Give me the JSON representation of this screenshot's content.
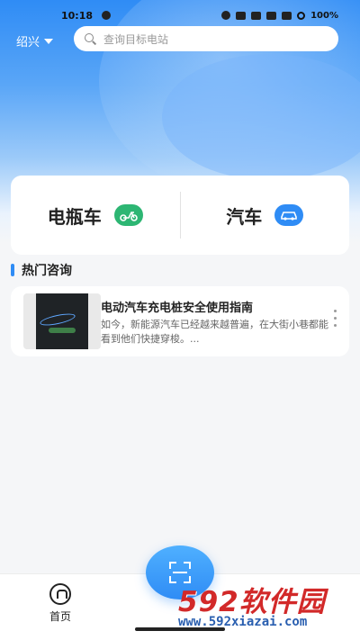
{
  "status_bar": {
    "time": "10:18",
    "battery": "100%"
  },
  "header": {
    "city": "绍兴",
    "search_placeholder": "查询目标电站"
  },
  "vehicle_types": [
    {
      "label": "电瓶车",
      "icon": "scooter-icon",
      "color": "#2db673"
    },
    {
      "label": "汽车",
      "icon": "car-icon",
      "color": "#2f8cf5"
    }
  ],
  "hot_section": {
    "title": "热门咨询",
    "items": [
      {
        "title": "电动汽车充电桩安全使用指南",
        "desc": "如今，新能源汽车已经越来越普遍，在大街小巷都能看到他们快捷穿梭。..."
      }
    ]
  },
  "bottom_nav": {
    "home_label": "首页",
    "scan_icon": "scan-icon"
  },
  "watermark": {
    "logo_text": "592软件园",
    "url": "www.592xiazai.com"
  },
  "colors": {
    "accent": "#2f8cf5",
    "green": "#2db673"
  }
}
